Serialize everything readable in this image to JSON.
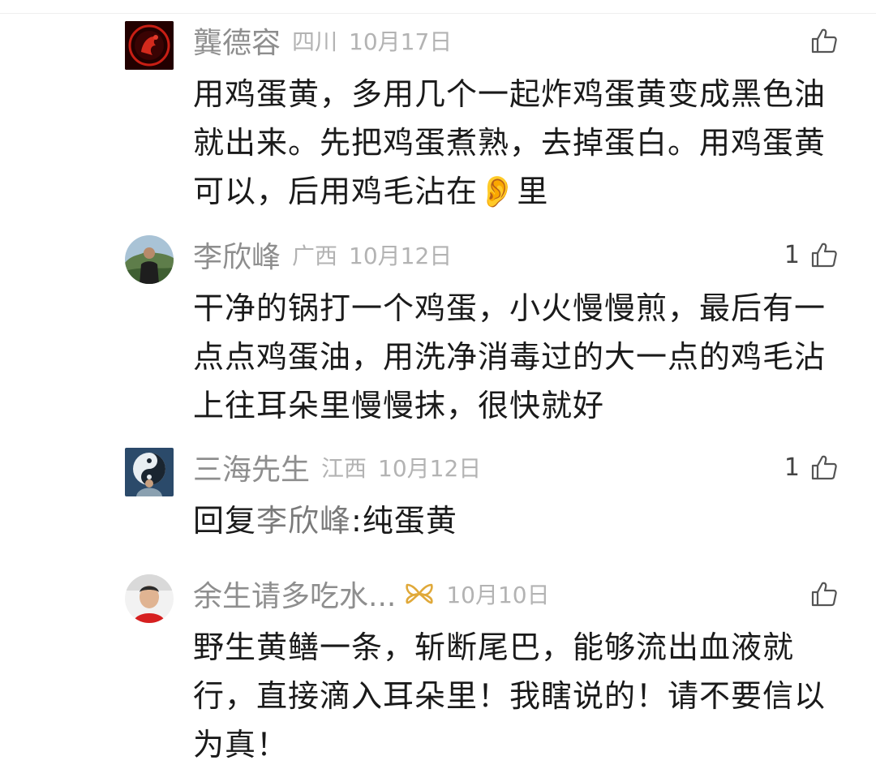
{
  "comments": [
    {
      "name": "龔德容",
      "location": "四川",
      "date": "10月17日",
      "likes": "",
      "text_before": "用鸡蛋黄，多用几个一起炸鸡蛋黄变成黑色油就出来。先把鸡蛋煮熟，去掉蛋白。用鸡蛋黄可以，后用鸡毛沾在",
      "ear_emoji": "👂",
      "text_after": "里"
    },
    {
      "name": "李欣峰",
      "location": "广西",
      "date": "10月12日",
      "likes": "1",
      "text": "干净的锅打一个鸡蛋，小火慢慢煎，最后有一点点鸡蛋油，用洗净消毒过的大一点的鸡毛沾上往耳朵里慢慢抹，很快就好"
    },
    {
      "name": "三海先生",
      "location": "江西",
      "date": "10月12日",
      "likes": "1",
      "reply_prefix": "回复",
      "reply_to": "李欣峰",
      "reply_text": ":纯蛋黄"
    },
    {
      "name": "余生请多吃水...",
      "location": "",
      "date": "10月10日",
      "likes": "",
      "text": "野生黄鳝一条，斩断尾巴，能够流出血液就行，直接滴入耳朵里！我瞎说的！请不要信以为真！"
    }
  ],
  "icons": {
    "like": "thumbs-up-icon",
    "badge": "gold-ribbon-badge-icon"
  },
  "colors": {
    "name": "#8e8e8e",
    "meta": "#b3b3b3",
    "text": "#1a1a1a",
    "badge": "#e0a93a"
  }
}
